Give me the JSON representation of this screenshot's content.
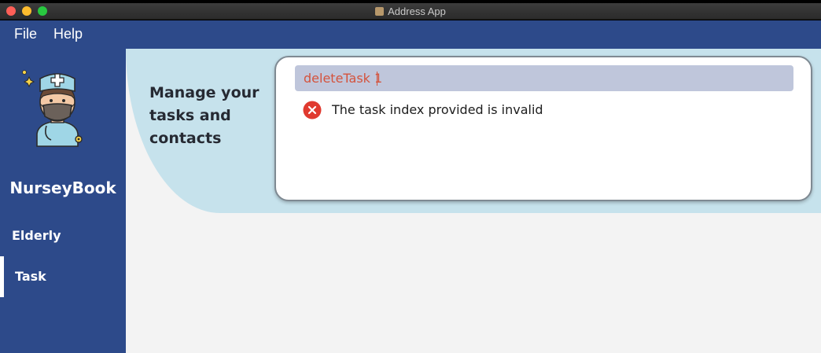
{
  "window": {
    "title": "Address App"
  },
  "menu": {
    "file": "File",
    "help": "Help"
  },
  "sidebar": {
    "brand": "NurseyBook",
    "avatar_icon": "nurse-avatar-icon",
    "items": [
      {
        "label": "Elderly",
        "active": false
      },
      {
        "label": "Task",
        "active": true
      }
    ]
  },
  "hero": {
    "tagline": "Manage your tasks and contacts"
  },
  "command": {
    "value": "deleteTask 1"
  },
  "result": {
    "message": "The task index provided is invalid",
    "status": "error",
    "icon": "error-icon"
  },
  "colors": {
    "primary": "#2d4a8a",
    "hero_bg": "#c6e2ec",
    "command_bg": "#bfc6db",
    "command_text": "#d4533d",
    "error": "#e03a2f"
  }
}
